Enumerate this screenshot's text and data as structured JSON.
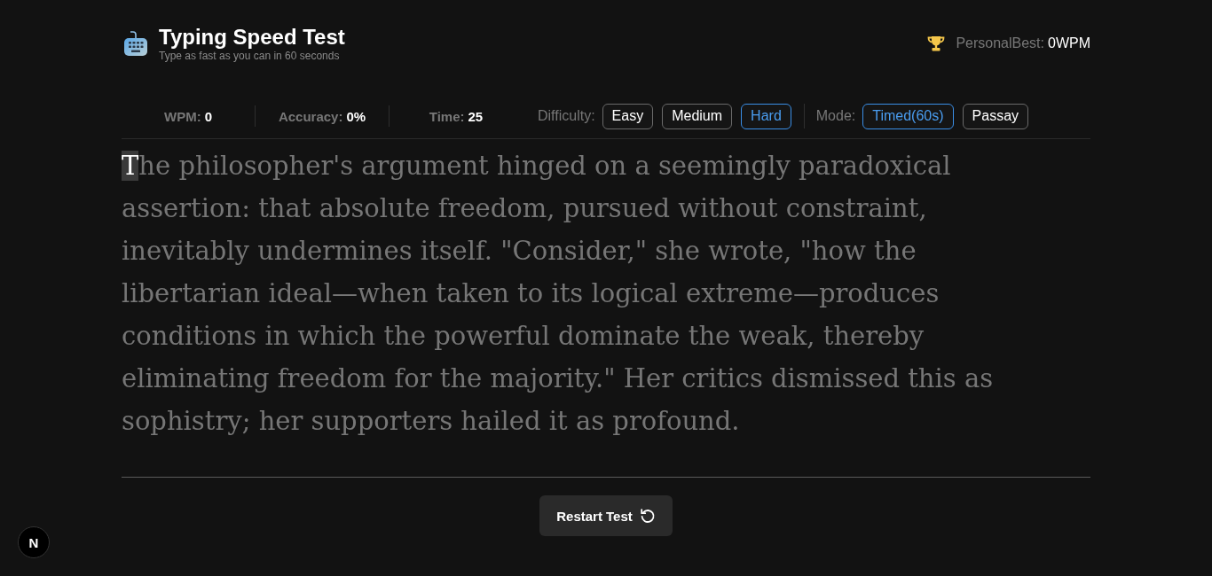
{
  "header": {
    "title": "Typing Speed Test",
    "subtitle": "Type as fast as you can in 60 seconds"
  },
  "personal_best": {
    "label": "PersonalBest:",
    "value": "0WPM"
  },
  "stats": [
    {
      "label": "WPM:",
      "value": "0"
    },
    {
      "label": "Accuracy:",
      "value": "0%"
    },
    {
      "label": "Time:",
      "value": "25"
    }
  ],
  "difficulty": {
    "label": "Difficulty:",
    "options": [
      {
        "label": "Easy",
        "selected": false
      },
      {
        "label": "Medium",
        "selected": false
      },
      {
        "label": "Hard",
        "selected": true
      }
    ]
  },
  "mode": {
    "label": "Mode:",
    "options": [
      {
        "label": "Timed(60s)",
        "selected": true
      },
      {
        "label": "Passay",
        "selected": false
      }
    ]
  },
  "passage": {
    "current_char": "T",
    "remaining_text": "he philosopher's argument hinged on a seemingly paradoxical assertion: that absolute freedom, pursued without constraint, inevitably undermines itself. \"Consider,\" she wrote, \"how the libertarian ideal—when taken to its logical extreme—produces conditions in which the powerful dominate the weak, thereby eliminating freedom for the majority.\" Her critics dismissed this as sophistry; her supporters hailed it as profound."
  },
  "restart_button": {
    "label": "Restart Test"
  },
  "dev_badge": {
    "label": "N"
  }
}
